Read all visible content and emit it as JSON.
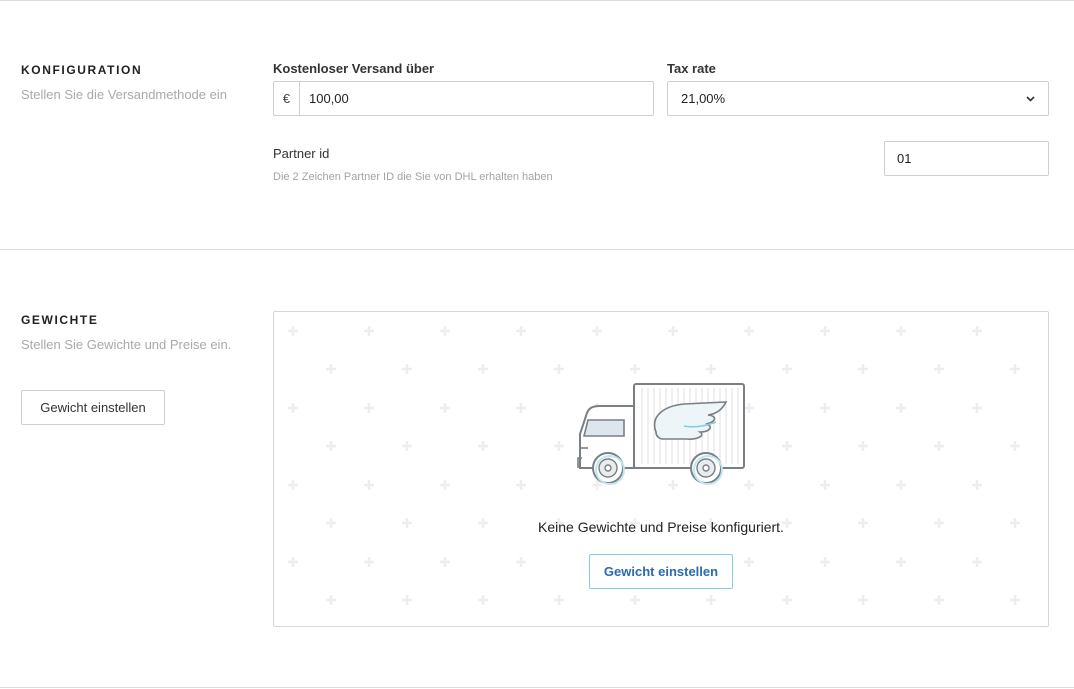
{
  "konfiguration": {
    "title": "KONFIGURATION",
    "subtitle": "Stellen Sie die Versandmethode ein",
    "free_shipping": {
      "label": "Kostenloser Versand über",
      "currency": "€",
      "value": "100,00"
    },
    "tax_rate": {
      "label": "Tax rate",
      "value": "21,00%"
    },
    "partner_id": {
      "label": "Partner id",
      "help": "Die 2 Zeichen Partner ID die Sie von DHL erhalten haben",
      "value": "01"
    }
  },
  "gewichte": {
    "title": "GEWICHTE",
    "subtitle": "Stellen Sie Gewichte und Preise ein.",
    "button_label": "Gewicht einstellen",
    "empty_state": {
      "illustration": "delivery-truck-icon",
      "message": "Keine Gewichte und Preise konfiguriert.",
      "button_label": "Gewicht einstellen"
    }
  },
  "colors": {
    "primary_text": "#2a6ab0",
    "primary_border": "#7fd0df",
    "muted_text": "#a9a9a9"
  }
}
